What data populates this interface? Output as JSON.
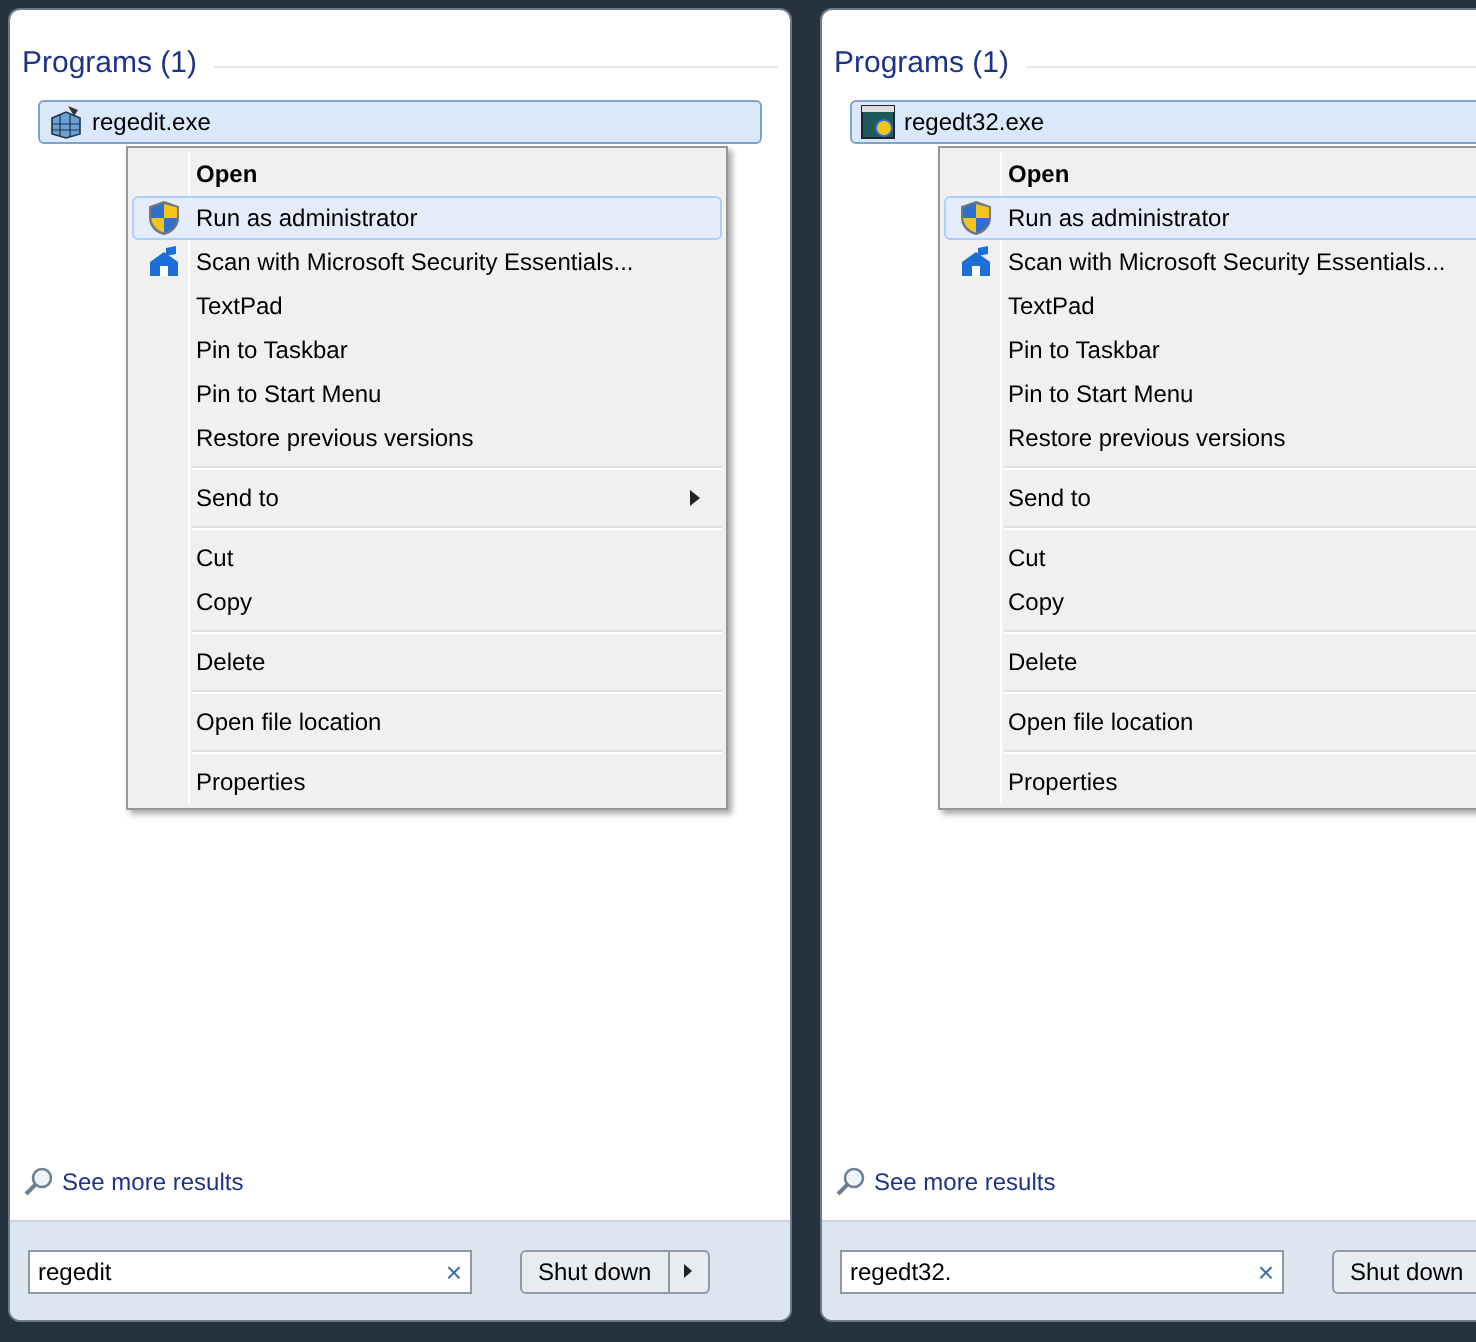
{
  "panels": [
    {
      "heading": "Programs (1)",
      "program": {
        "name": "regedit.exe",
        "selected": true,
        "kind": "regedit"
      },
      "more_results": "See more results",
      "search": {
        "value": "regedit"
      },
      "clear": "×",
      "shutdown": "Shut down",
      "menu": [
        {
          "kind": "item",
          "label": "Open",
          "default": true,
          "selected": false
        },
        {
          "kind": "elevated",
          "label": "Run as administrator",
          "default": false,
          "selected": true
        },
        {
          "kind": "scan",
          "label": "Scan with Microsoft Security Essentials...",
          "default": false,
          "selected": false
        },
        {
          "kind": "item",
          "label": "TextPad",
          "default": false,
          "selected": false
        },
        {
          "kind": "item",
          "label": "Pin to Taskbar",
          "default": false,
          "selected": false
        },
        {
          "kind": "item",
          "label": "Pin to Start Menu",
          "default": false,
          "selected": false
        },
        {
          "kind": "item",
          "label": "Restore previous versions",
          "default": false,
          "selected": false
        },
        {
          "kind": "separator"
        },
        {
          "kind": "submenu",
          "label": "Send to",
          "default": false,
          "selected": false
        },
        {
          "kind": "separator"
        },
        {
          "kind": "item",
          "label": "Cut",
          "default": false,
          "selected": false
        },
        {
          "kind": "item",
          "label": "Copy",
          "default": false,
          "selected": false
        },
        {
          "kind": "separator"
        },
        {
          "kind": "item",
          "label": "Delete",
          "default": false,
          "selected": false
        },
        {
          "kind": "separator"
        },
        {
          "kind": "item",
          "label": "Open file location",
          "default": false,
          "selected": false
        },
        {
          "kind": "separator"
        },
        {
          "kind": "item",
          "label": "Properties",
          "default": false,
          "selected": false
        }
      ]
    },
    {
      "heading": "Programs (1)",
      "program": {
        "name": "regedt32.exe",
        "selected": true,
        "kind": "regedt32"
      },
      "more_results": "See more results",
      "search": {
        "value": "regedt32."
      },
      "clear": "×",
      "shutdown": "Shut down",
      "menu": [
        {
          "kind": "item",
          "label": "Open",
          "default": true,
          "selected": false
        },
        {
          "kind": "elevated",
          "label": "Run as administrator",
          "default": false,
          "selected": true
        },
        {
          "kind": "scan",
          "label": "Scan with Microsoft Security Essentials...",
          "default": false,
          "selected": false
        },
        {
          "kind": "item",
          "label": "TextPad",
          "default": false,
          "selected": false
        },
        {
          "kind": "item",
          "label": "Pin to Taskbar",
          "default": false,
          "selected": false
        },
        {
          "kind": "item",
          "label": "Pin to Start Menu",
          "default": false,
          "selected": false
        },
        {
          "kind": "item",
          "label": "Restore previous versions",
          "default": false,
          "selected": false
        },
        {
          "kind": "separator"
        },
        {
          "kind": "item",
          "label": "Send to",
          "default": false,
          "selected": false
        },
        {
          "kind": "separator"
        },
        {
          "kind": "item",
          "label": "Cut",
          "default": false,
          "selected": false
        },
        {
          "kind": "item",
          "label": "Copy",
          "default": false,
          "selected": false
        },
        {
          "kind": "separator"
        },
        {
          "kind": "item",
          "label": "Delete",
          "default": false,
          "selected": false
        },
        {
          "kind": "separator"
        },
        {
          "kind": "item",
          "label": "Open file location",
          "default": false,
          "selected": false
        },
        {
          "kind": "separator"
        },
        {
          "kind": "item",
          "label": "Properties",
          "default": false,
          "selected": false
        }
      ]
    }
  ]
}
